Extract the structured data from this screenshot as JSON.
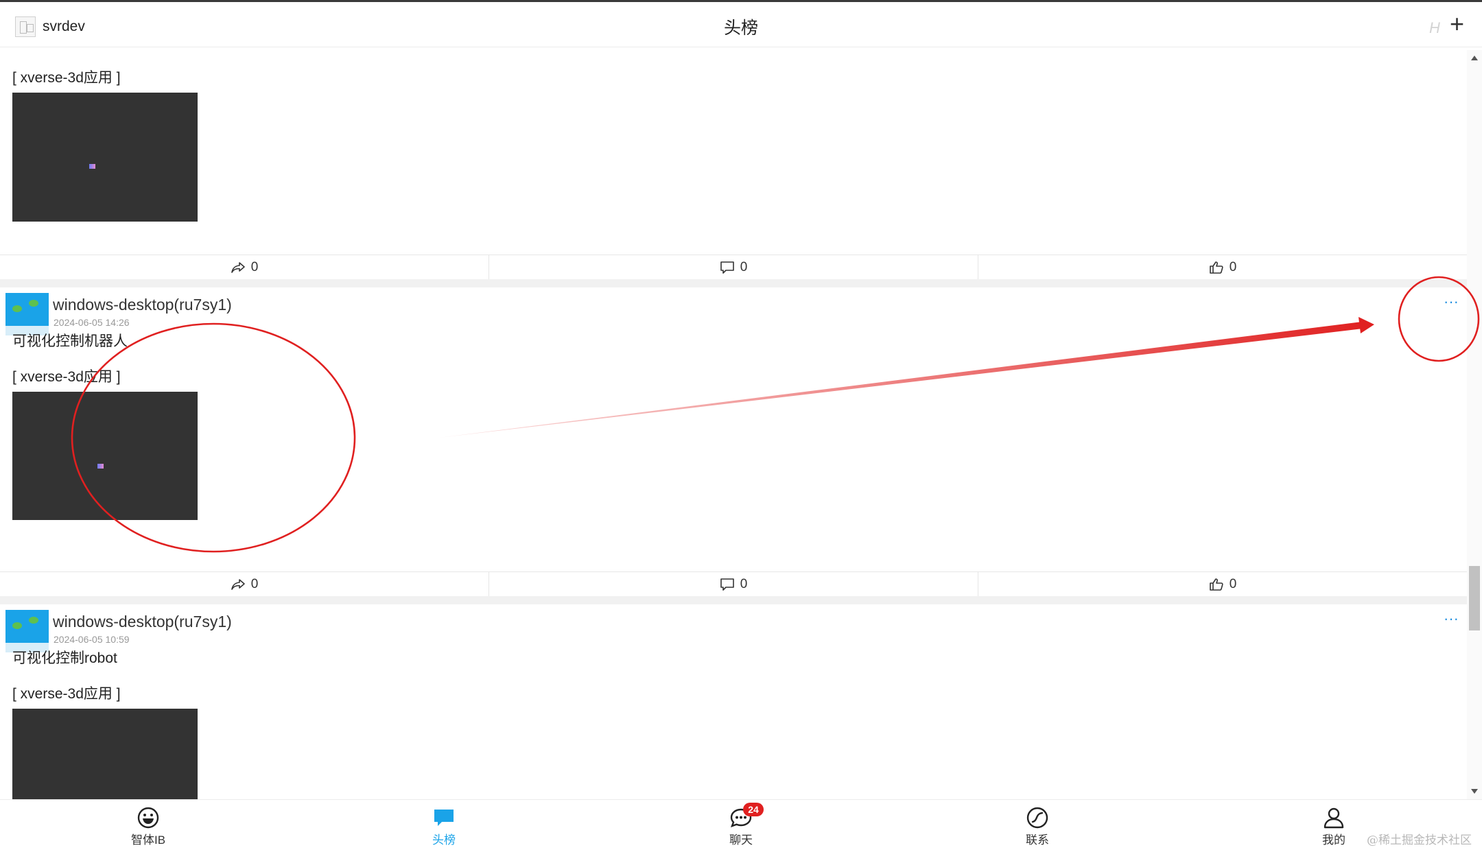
{
  "header": {
    "username": "svrdev",
    "title": "头榜",
    "h_label": "H",
    "add_label": "+"
  },
  "posts": [
    {
      "tag": "[ xverse-3d应用 ]",
      "actions": {
        "share": "0",
        "comment": "0",
        "like": "0"
      }
    },
    {
      "author": "windows-desktop(ru7sy1)",
      "time": "2024-06-05 14:26",
      "more": "···",
      "text": "可视化控制机器人",
      "tag": "[ xverse-3d应用 ]",
      "actions": {
        "share": "0",
        "comment": "0",
        "like": "0"
      }
    },
    {
      "author": "windows-desktop(ru7sy1)",
      "time": "2024-06-05 10:59",
      "more": "···",
      "text": "可视化控制robot",
      "tag": "[ xverse-3d应用 ]"
    }
  ],
  "nav": {
    "items": [
      {
        "label": "智体IB",
        "icon": "smiley-icon"
      },
      {
        "label": "头榜",
        "icon": "chat-bubble-icon"
      },
      {
        "label": "聊天",
        "icon": "chat-icon",
        "badge": "24"
      },
      {
        "label": "联系",
        "icon": "compass-icon"
      },
      {
        "label": "我的",
        "icon": "person-icon"
      }
    ],
    "active_color": "#1aa3e8"
  },
  "watermark": "@稀土掘金技术社区",
  "colors": {
    "accent": "#1aa3e8",
    "annotation": "#e02020",
    "thumbnail": "#333333"
  }
}
